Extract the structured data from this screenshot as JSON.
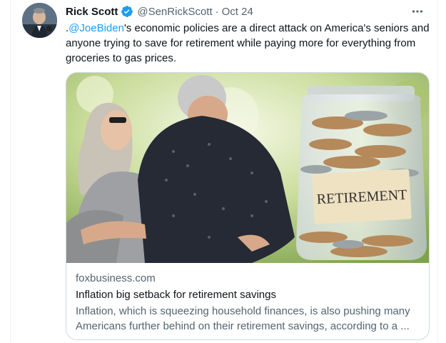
{
  "author": {
    "name": "Rick Scott",
    "handle": "@SenRickScott",
    "separator": "·",
    "date": "Oct 24",
    "avatar_icon": "senator-portrait",
    "verified_icon": "verified-badge-icon"
  },
  "tweet": {
    "text_prefix": ".",
    "mention": "@JoeBiden",
    "text_body": "'s economic policies are a direct attack on America's seniors and anyone trying to save for retirement while paying more for everything from groceries to gas prices."
  },
  "card": {
    "image_alt": "Older couple embracing beside a glass jar of coins labeled Retirement",
    "jar_label": "RETIREMENT",
    "domain": "foxbusiness.com",
    "title": "Inflation big setback for retirement savings",
    "description": "Inflation, which is squeezing household finances, is also pushing many Americans further behind on their retirement savings, according to a ..."
  },
  "colors": {
    "link": "#1d9bf0",
    "secondary_text": "#536471",
    "border": "#cfd9de"
  }
}
